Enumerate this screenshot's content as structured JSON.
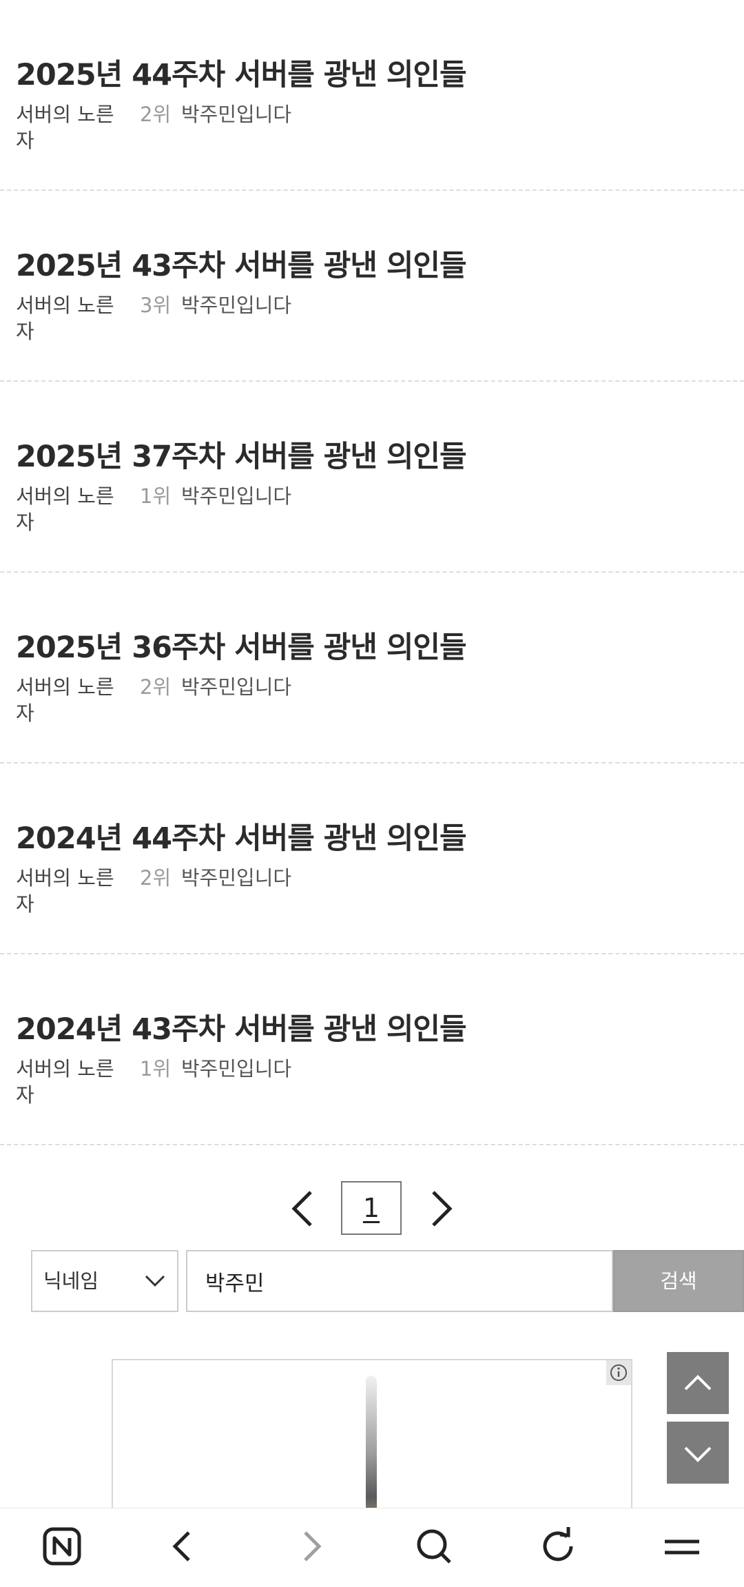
{
  "posts": [
    {
      "title": "2025년 44주차 서버를 광낸 의인들",
      "board": "서버의 노른자",
      "rank": "2위",
      "author": "박주민입니다"
    },
    {
      "title": "2025년 43주차 서버를 광낸 의인들",
      "board": "서버의 노른자",
      "rank": "3위",
      "author": "박주민입니다"
    },
    {
      "title": "2025년 37주차 서버를 광낸 의인들",
      "board": "서버의 노른자",
      "rank": "1위",
      "author": "박주민입니다"
    },
    {
      "title": "2025년 36주차 서버를 광낸 의인들",
      "board": "서버의 노른자",
      "rank": "2위",
      "author": "박주민입니다"
    },
    {
      "title": "2024년 44주차 서버를 광낸 의인들",
      "board": "서버의 노른자",
      "rank": "2위",
      "author": "박주민입니다"
    },
    {
      "title": "2024년 43주차 서버를 광낸 의인들",
      "board": "서버의 노른자",
      "rank": "1위",
      "author": "박주민입니다"
    }
  ],
  "pagination": {
    "current_page": "1"
  },
  "search": {
    "field_option": "닉네임",
    "query": "박주민",
    "button_label": "검색"
  },
  "colors": {
    "search_button": "#a3a3a3",
    "scroll_button": "#7c7c7c",
    "divider": "#dcdcdc"
  },
  "icons": {
    "prev": "chevron-left-icon",
    "next": "chevron-right-icon",
    "select": "chevron-down-icon",
    "scroll_up": "chevron-up-icon",
    "scroll_down": "chevron-down-icon",
    "ad_info": "info-icon",
    "nav_home": "naver-n-icon",
    "nav_back": "back-arrow-icon",
    "nav_forward": "forward-arrow-icon",
    "nav_search": "search-icon",
    "nav_refresh": "refresh-icon",
    "nav_menu": "menu-icon"
  }
}
